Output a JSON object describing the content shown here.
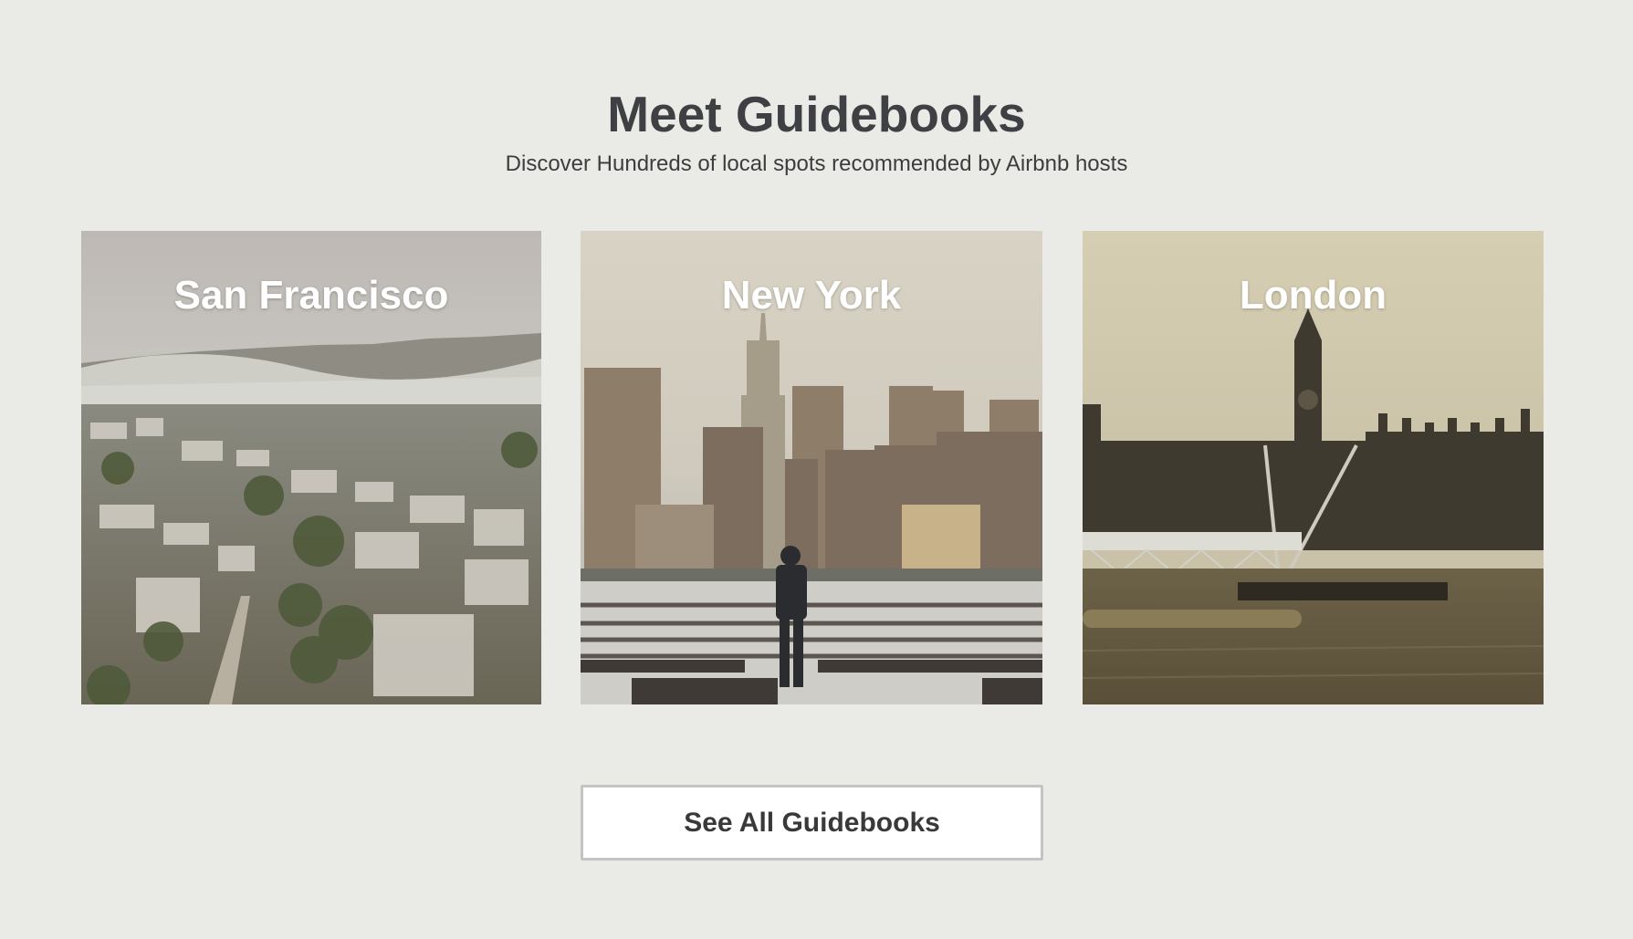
{
  "section": {
    "title": "Meet Guidebooks",
    "subtitle": "Discover Hundreds of local spots recommended by Airbnb hosts"
  },
  "guidebooks": [
    {
      "city": "San Francisco",
      "image": "san-francisco-hillside-photo"
    },
    {
      "city": "New York",
      "image": "new-york-skyline-photo"
    },
    {
      "city": "London",
      "image": "london-big-ben-photo"
    }
  ],
  "cta": {
    "label": "See All Guidebooks"
  },
  "colors": {
    "background": "#eaeae6",
    "heading": "#3f4043",
    "card_title": "#ffffff",
    "button_border": "#c4c4c4"
  }
}
